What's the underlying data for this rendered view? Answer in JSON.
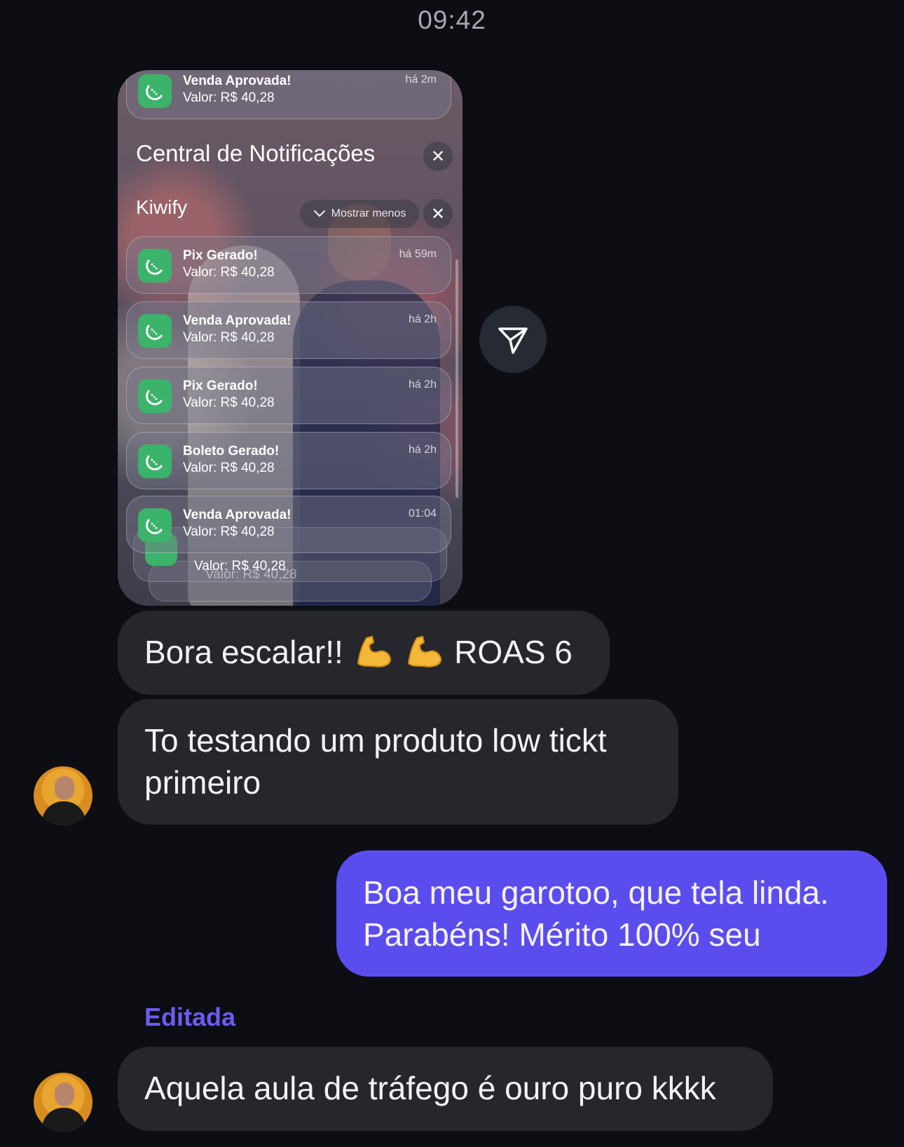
{
  "header": {
    "time": "09:42"
  },
  "screenshot": {
    "top_notification": {
      "title": "Venda Aprovada!",
      "value": "Valor: R$ 40,28",
      "time": "há 2m"
    },
    "center_title": "Central de Notificações",
    "group": {
      "name": "Kiwify",
      "toggle_label": "Mostrar menos"
    },
    "notifications": [
      {
        "title": "Pix Gerado!",
        "value": "Valor: R$ 40,28",
        "time": "há 59m"
      },
      {
        "title": "Venda Aprovada!",
        "value": "Valor: R$ 40,28",
        "time": "há 2h"
      },
      {
        "title": "Pix Gerado!",
        "value": "Valor: R$ 40,28",
        "time": "há 2h"
      },
      {
        "title": "Boleto Gerado!",
        "value": "Valor: R$ 40,28",
        "time": "há 2h"
      },
      {
        "title": "Venda Aprovada!",
        "value": "Valor: R$ 40,28",
        "time": "01:04"
      }
    ],
    "stacked_value": "Valor: R$ 40,28",
    "stacked_value_2": "Valor: R$ 40,28",
    "app_icon": "kiwi-icon",
    "app_color": "#3cb36a"
  },
  "messages": [
    {
      "text_before": "Bora escalar!!",
      "text_after": "ROAS 6",
      "emoji": "flexed-biceps-icon"
    },
    {
      "text": "To testando um produto low tickt primeiro"
    },
    {
      "text": "Boa meu garotoo, que tela linda. Parabéns! Mérito 100% seu"
    },
    {
      "label": "Editada",
      "text": "Aquela aula de tráfego é ouro puro kkkk"
    }
  ],
  "colors": {
    "outgoing": "#5b4ded",
    "incoming": "#25272d",
    "edited_label": "#6b5df0"
  }
}
